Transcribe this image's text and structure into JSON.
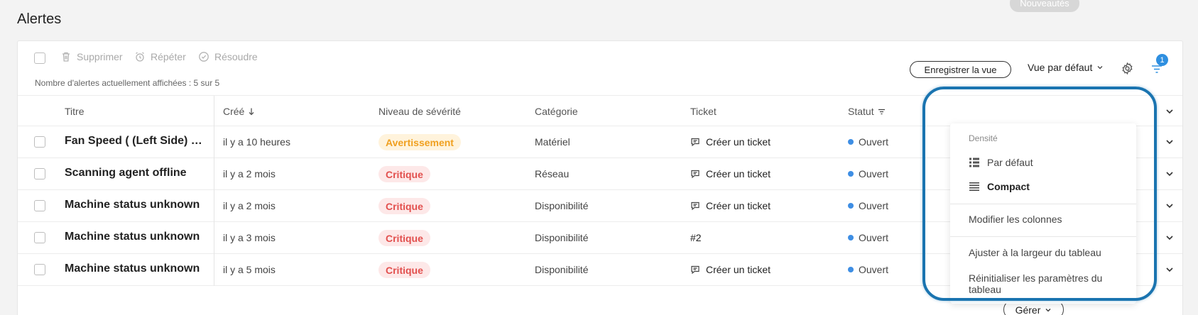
{
  "page": {
    "title": "Alertes",
    "news_label": "Nouveautés"
  },
  "toolbar": {
    "delete_label": "Supprimer",
    "repeat_label": "Répéter",
    "resolve_label": "Résoudre",
    "count_text": "Nombre d'alertes actuellement affichées : 5 sur 5",
    "save_view_label": "Enregistrer la vue",
    "view_select_label": "Vue par défaut",
    "filter_count": "1"
  },
  "table": {
    "headers": {
      "title": "Titre",
      "created": "Créé",
      "severity": "Niveau de sévérité",
      "category": "Catégorie",
      "ticket": "Ticket",
      "status": "Statut"
    },
    "rows": [
      {
        "title": "Fan Speed ( (Left Side) an…",
        "created": "il y a 10 heures",
        "severity": "Avertissement",
        "severity_level": "warning",
        "category": "Matériel",
        "ticket": "Créer un ticket",
        "ticket_icon": true,
        "status": "Ouvert"
      },
      {
        "title": "Scanning agent offline",
        "created": "il y a 2 mois",
        "severity": "Critique",
        "severity_level": "critical",
        "category": "Réseau",
        "ticket": "Créer un ticket",
        "ticket_icon": true,
        "status": "Ouvert"
      },
      {
        "title": "Machine status unknown",
        "created": "il y a 2 mois",
        "severity": "Critique",
        "severity_level": "critical",
        "category": "Disponibilité",
        "ticket": "Créer un ticket",
        "ticket_icon": true,
        "status": "Ouvert"
      },
      {
        "title": "Machine status unknown",
        "created": "il y a 3 mois",
        "severity": "Critique",
        "severity_level": "critical",
        "category": "Disponibilité",
        "ticket": "#2",
        "ticket_icon": false,
        "status": "Ouvert"
      },
      {
        "title": "Machine status unknown",
        "created": "il y a 5 mois",
        "severity": "Critique",
        "severity_level": "critical",
        "category": "Disponibilité",
        "ticket": "Créer un ticket",
        "ticket_icon": true,
        "status": "Ouvert"
      }
    ],
    "manage_label": "Gérer"
  },
  "settings_menu": {
    "density_heading": "Densité",
    "density_default": "Par défaut",
    "density_compact": "Compact",
    "edit_columns": "Modifier les colonnes",
    "fit_width": "Ajuster à la largeur du tableau",
    "reset_settings": "Réinitialiser les paramètres du tableau"
  },
  "colors": {
    "accent": "#2f8fe0",
    "highlight": "#1a74b0",
    "warning": "#f0a020",
    "critical": "#e2504e",
    "status_open": "#3e8ee4"
  }
}
